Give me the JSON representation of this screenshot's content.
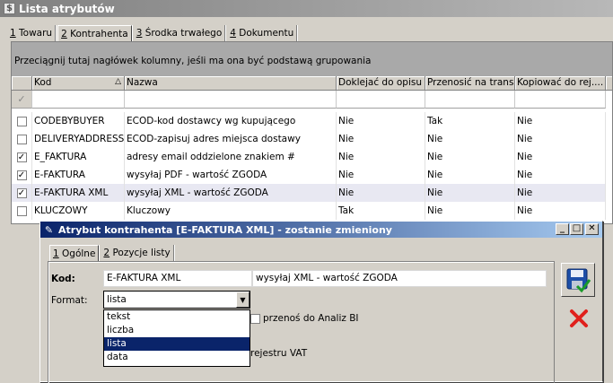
{
  "window": {
    "title": "Lista atrybutów"
  },
  "tabs": [
    {
      "key": "1",
      "label": " Towaru"
    },
    {
      "key": "2",
      "label": " Kontrahenta"
    },
    {
      "key": "3",
      "label": " Środka trwałego"
    },
    {
      "key": "4",
      "label": " Dokumentu"
    }
  ],
  "grid": {
    "group_hint": "Przeciągnij tutaj nagłówek kolumny, jeśli ma ona być podstawą grupowania",
    "columns": [
      "Kod",
      "Nazwa",
      "Doklejać do opisu",
      "Przenosić na trans.",
      "Kopiować do rej...."
    ],
    "rows": [
      {
        "checked": false,
        "kod": "CODEBYBUYER",
        "nazwa": "ECOD-kod dostawcy wg kupującego",
        "doklejac": "Nie",
        "przenosic": "Tak",
        "kopiowac": "Nie"
      },
      {
        "checked": false,
        "kod": "DELIVERYADDRESS",
        "nazwa": "ECOD-zapisuj adres miejsca dostawy",
        "doklejac": "Nie",
        "przenosic": "Nie",
        "kopiowac": "Nie"
      },
      {
        "checked": true,
        "kod": "E_FAKTURA",
        "nazwa": "adresy email oddzielone znakiem #",
        "doklejac": "Nie",
        "przenosic": "Nie",
        "kopiowac": "Nie"
      },
      {
        "checked": true,
        "kod": "E-FAKTURA",
        "nazwa": "wysyłaj PDF  - wartość ZGODA",
        "doklejac": "Nie",
        "przenosic": "Nie",
        "kopiowac": "Nie"
      },
      {
        "checked": true,
        "kod": "E-FAKTURA XML",
        "nazwa": "wysyłaj XML  - wartość ZGODA",
        "doklejac": "Nie",
        "przenosic": "Nie",
        "kopiowac": "Nie"
      },
      {
        "checked": false,
        "kod": "KLUCZOWY",
        "nazwa": "Kluczowy",
        "doklejac": "Tak",
        "przenosic": "Nie",
        "kopiowac": "Nie"
      }
    ]
  },
  "dialog": {
    "title": "Atrybut kontrahenta [E-FAKTURA XML] - zostanie zmieniony",
    "tabs": [
      {
        "key": "1",
        "label": " Ogólne"
      },
      {
        "key": "2",
        "label": " Pozycje listy"
      }
    ],
    "kod_label": "Kod:",
    "kod_value": "E-FAKTURA XML",
    "nazwa_value": "wysyłaj XML  - wartość ZGODA",
    "format_label": "Format:",
    "format_value": "lista",
    "format_options": [
      "tekst",
      "liczba",
      "lista",
      "data"
    ],
    "analiz_label": "przenoś do Analiz BI",
    "vat_label": "rejestru VAT"
  },
  "colors": {
    "active_title": "#0a246a",
    "inactive_title": "#808080",
    "selection": "#0a246a",
    "cancel_red": "#e0201c"
  }
}
